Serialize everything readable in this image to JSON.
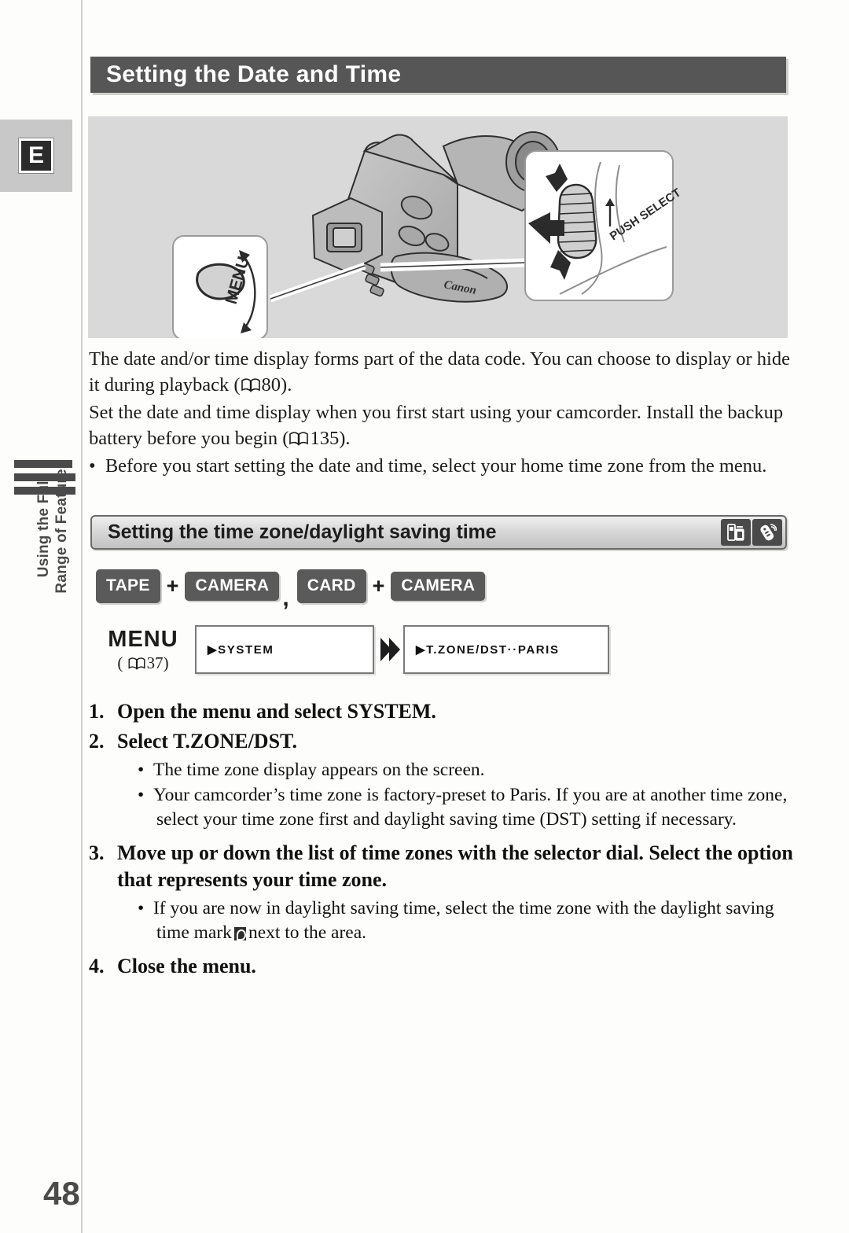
{
  "page": {
    "number": "48",
    "language_tab": "E",
    "chapter_tab_line1": "Using the Full",
    "chapter_tab_line2": "Range of Features"
  },
  "header": {
    "title": "Setting the Date and Time"
  },
  "illustration": {
    "brand": "Canon",
    "menu_callout_label": "MENU",
    "dial_callout_label": "PUSH SELECT"
  },
  "intro": {
    "para1": "The date and/or time display forms part of the data code. You can choose to display or hide it during playback (",
    "para1_ref": "80",
    "para1_end": ").",
    "para2": "Set the date and time display when you first start using your camcorder. Install the backup battery before you begin (",
    "para2_ref": "135",
    "para2_end": ").",
    "bullet1": "Before you start setting the date and time, select your home time zone from the menu."
  },
  "subsection": {
    "title": "Setting the time zone/daylight saving time",
    "icons": [
      "memory-card-icon",
      "wireless-remote-icon"
    ]
  },
  "modes": {
    "badge1": "TAPE",
    "badge2": "CAMERA",
    "badge3": "CARD",
    "badge4": "CAMERA",
    "plus": "+",
    "comma": ","
  },
  "menu_flow": {
    "label": "MENU",
    "page_ref": "37",
    "screen1": "▶SYSTEM",
    "screen2": "▶T.ZONE/DST··PARIS"
  },
  "steps": [
    {
      "num": "1.",
      "text": "Open the menu and select SYSTEM.",
      "substeps": []
    },
    {
      "num": "2.",
      "text": "Select T.ZONE/DST.",
      "substeps": [
        "The time zone display appears on the screen.",
        "Your camcorder’s time zone is factory-preset to Paris. If you are at another time zone, select your time zone first and daylight saving time (DST) setting if necessary."
      ]
    },
    {
      "num": "3.",
      "text": "Move up or down the list of time zones with the selector dial. Select the option that represents your time zone.",
      "substeps": []
    },
    {
      "num": "4.",
      "text": "Close the menu.",
      "substeps": []
    }
  ],
  "step3_bullet": {
    "part1": "If you are now in daylight saving time, select the time zone with the daylight saving time mark",
    "part2": "next to the area."
  },
  "colors": {
    "title_bar": "#565656",
    "illustration_bg": "#d9d9d9",
    "badge": "#5a5a5a",
    "tab_gray": "#c8c8c8",
    "text": "#111111"
  }
}
